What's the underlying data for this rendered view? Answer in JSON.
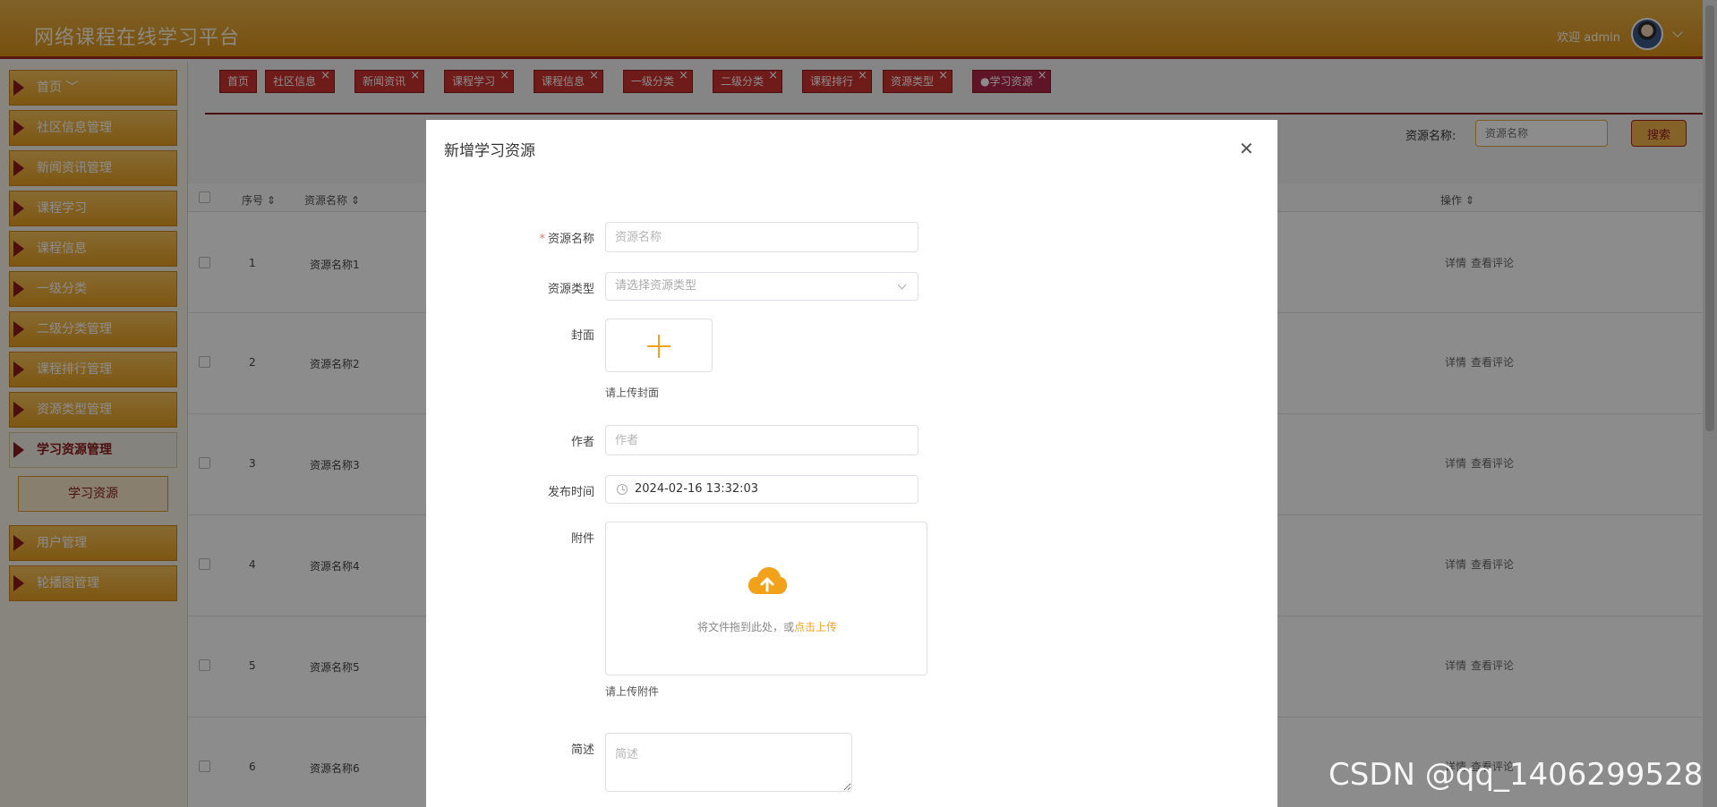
{
  "header": {
    "app_title": "网络课程在线学习平台",
    "welcome": "欢迎 admin"
  },
  "sidebar": {
    "items": [
      {
        "label": "首页 ﹀"
      },
      {
        "label": "社区信息管理"
      },
      {
        "label": "新闻资讯管理"
      },
      {
        "label": "课程学习"
      },
      {
        "label": "课程信息"
      },
      {
        "label": "一级分类"
      },
      {
        "label": "二级分类管理"
      },
      {
        "label": "课程排行管理"
      },
      {
        "label": "资源类型管理"
      },
      {
        "label": "学习资源管理"
      },
      {
        "label": "用户管理"
      },
      {
        "label": "轮播图管理"
      }
    ],
    "submenu_label": "学习资源"
  },
  "tabs": [
    {
      "label": "首页"
    },
    {
      "label": "社区信息"
    },
    {
      "label": "新闻资讯"
    },
    {
      "label": "课程学习"
    },
    {
      "label": "课程信息"
    },
    {
      "label": "一级分类"
    },
    {
      "label": "二级分类"
    },
    {
      "label": "课程排行"
    },
    {
      "label": "资源类型"
    },
    {
      "label": "●学习资源"
    }
  ],
  "search": {
    "label": "资源名称:",
    "placeholder": "资源名称",
    "button": "搜索"
  },
  "table": {
    "headers": {
      "index": "序号 ⇕",
      "name": "资源名称 ⇕",
      "ops": "操作 ⇕"
    },
    "rows": [
      {
        "index": "1",
        "name": "资源名称1"
      },
      {
        "index": "2",
        "name": "资源名称2"
      },
      {
        "index": "3",
        "name": "资源名称3"
      },
      {
        "index": "4",
        "name": "资源名称4"
      },
      {
        "index": "5",
        "name": "资源名称5"
      },
      {
        "index": "6",
        "name": "资源名称6"
      }
    ],
    "op_detail": "详情",
    "op_comments": "查看评论"
  },
  "modal": {
    "title": "新增学习资源",
    "close_glyph": "✕",
    "fields": {
      "name_label": "资源名称",
      "name_placeholder": "资源名称",
      "type_label": "资源类型",
      "type_placeholder": "请选择资源类型",
      "cover_label": "封面",
      "cover_hint": "请上传封面",
      "author_label": "作者",
      "author_placeholder": "作者",
      "date_label": "发布时间",
      "date_value": "2024-02-16 13:32:03",
      "attachment_label": "附件",
      "drop_text": "将文件拖到此处，或",
      "drop_link": "点击上传",
      "attachment_hint": "请上传附件",
      "summary_label": "简述",
      "summary_placeholder": "简述"
    }
  },
  "watermark": "CSDN @qq_1406299528",
  "colors": {
    "header": "#e0a030",
    "accent": "#f2a11a",
    "dark_red": "#8b1a1a",
    "overlay": "rgba(0,0,0,0.45)"
  }
}
